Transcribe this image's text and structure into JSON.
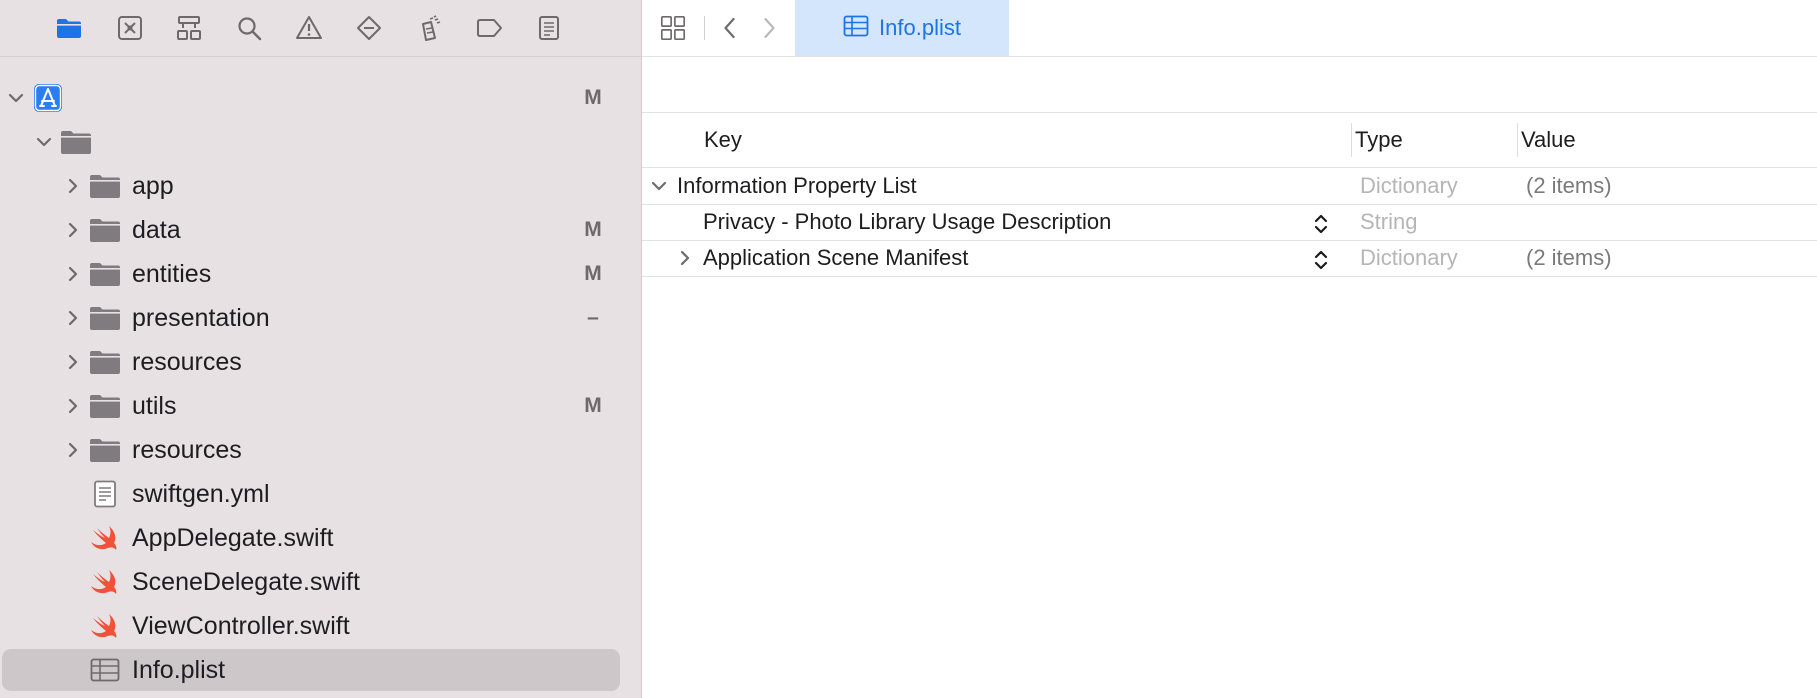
{
  "navigator": {
    "tools": [
      "folder-icon",
      "source-control-icon",
      "hierarchy-icon",
      "search-icon",
      "warning-icon",
      "test-icon",
      "debug-icon",
      "breakpoint-icon",
      "report-icon"
    ],
    "items": [
      {
        "label": "",
        "badge": "M",
        "icon": "app-project-icon",
        "expanded": true,
        "depth": 0
      },
      {
        "label": "",
        "badge": "",
        "icon": "folder-icon",
        "expanded": true,
        "depth": 1
      },
      {
        "label": "app",
        "badge": "",
        "icon": "folder-icon",
        "expanded": false,
        "depth": 2
      },
      {
        "label": "data",
        "badge": "M",
        "icon": "folder-icon",
        "expanded": false,
        "depth": 2
      },
      {
        "label": "entities",
        "badge": "M",
        "icon": "folder-icon",
        "expanded": false,
        "depth": 2
      },
      {
        "label": "presentation",
        "badge": "–",
        "icon": "folder-icon",
        "expanded": false,
        "depth": 2
      },
      {
        "label": "resources",
        "badge": "",
        "icon": "folder-icon",
        "expanded": false,
        "depth": 2
      },
      {
        "label": "utils",
        "badge": "M",
        "icon": "folder-icon",
        "expanded": false,
        "depth": 2
      },
      {
        "label": "resources",
        "badge": "",
        "icon": "folder-icon",
        "expanded": false,
        "depth": 2
      },
      {
        "label": "swiftgen.yml",
        "badge": "",
        "icon": "document-icon",
        "depth": 2
      },
      {
        "label": "AppDelegate.swift",
        "badge": "",
        "icon": "swift-icon",
        "depth": 2
      },
      {
        "label": "SceneDelegate.swift",
        "badge": "",
        "icon": "swift-icon",
        "depth": 2
      },
      {
        "label": "ViewController.swift",
        "badge": "",
        "icon": "swift-icon",
        "depth": 2
      },
      {
        "label": "Info.plist",
        "badge": "",
        "icon": "plist-icon",
        "depth": 2,
        "selected": true
      }
    ]
  },
  "editor": {
    "tab": {
      "label": "Info.plist",
      "icon": "plist-icon"
    },
    "columns": {
      "key": "Key",
      "type": "Type",
      "value": "Value"
    },
    "rows": [
      {
        "key": "Information Property List",
        "type": "Dictionary",
        "value": "(2 items)",
        "expanded": true,
        "indent": 0,
        "stepper": false
      },
      {
        "key": "Privacy - Photo Library Usage Description",
        "type": "String",
        "value": "",
        "indent": 1,
        "stepper": true
      },
      {
        "key": "Application Scene Manifest",
        "type": "Dictionary",
        "value": "(2 items)",
        "expanded": false,
        "indent": 1,
        "stepper": true
      }
    ]
  },
  "colors": {
    "accent": "#1c74e6",
    "sidebar": "#e7e1e3",
    "selected": "#cec7ca",
    "swift": "#f05138",
    "tab": "#d4e6fb"
  }
}
